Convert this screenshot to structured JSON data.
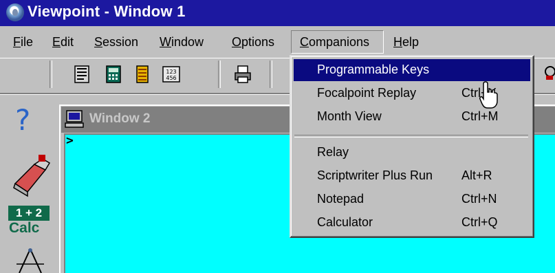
{
  "window": {
    "title": "Viewpoint - Window 1"
  },
  "menubar": {
    "items": [
      {
        "label": "File",
        "accel_index": 0
      },
      {
        "label": "Edit",
        "accel_index": 0
      },
      {
        "label": "Session",
        "accel_index": 0
      },
      {
        "label": "Window",
        "accel_index": 0
      },
      {
        "label": "Options",
        "accel_index": 0
      },
      {
        "label": "Companions",
        "accel_index": 0,
        "active": true
      },
      {
        "label": "Help",
        "accel_index": 0
      }
    ]
  },
  "dropdown": {
    "items": [
      {
        "label": "Programmable Keys",
        "accel": "",
        "selected": true
      },
      {
        "label": "Focalpoint Replay",
        "accel": "Ctrl+Y"
      },
      {
        "label": "Month View",
        "accel": "Ctrl+M"
      },
      {
        "label": "Relay",
        "accel": ""
      },
      {
        "label": "Scriptwriter Plus Run",
        "accel": "Alt+R"
      },
      {
        "label": "Notepad",
        "accel": "Ctrl+N"
      },
      {
        "label": "Calculator",
        "accel": "Ctrl+Q"
      }
    ]
  },
  "child_window": {
    "title": "Window 2",
    "prompt": ">"
  },
  "leftbar": {
    "help": "?",
    "calc_badge": "1 + 2",
    "calc_label": "Calc"
  },
  "colors": {
    "titlebar": "#1c18a0",
    "selection": "#0a0a80",
    "client": "#00ffff",
    "calc": "#106a4a"
  },
  "toolbar": {
    "icons": [
      "document-icon",
      "calculator-icon",
      "notebook-icon",
      "numpad-icon",
      "printer-icon"
    ]
  }
}
